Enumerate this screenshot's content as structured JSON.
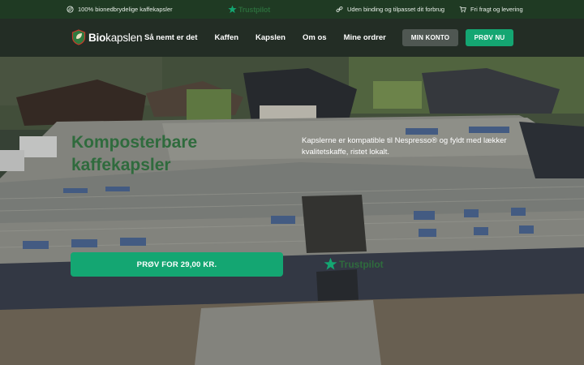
{
  "topbar": {
    "items": [
      {
        "icon": "leaf-icon",
        "text": "100% bionedbrydelige kaffekapsler"
      },
      {
        "icon": "link-icon",
        "text": "Uden binding og tilpasset dit forbrug"
      },
      {
        "icon": "cart-icon",
        "text": "Fri fragt og levering"
      }
    ],
    "trustpilot": "Trustpilot"
  },
  "navbar": {
    "logo_bold": "Bio",
    "logo_rest": "kapslen",
    "links": [
      "Så nemt er det",
      "Kaffen",
      "Kapslen",
      "Om os",
      "Mine ordrer"
    ],
    "account_label": "MIN KONTO",
    "try_label": "PRØV NU"
  },
  "hero": {
    "title_line1": "Komposterbare",
    "title_line2": "kaffekapsler",
    "description": "Kapslerne er kompatible til Nespresso® og fyldt med lækker kvalitetskaffe, ristet lokalt.",
    "cta_label": "PRØV FOR 29,00 KR.",
    "trustpilot": "Trustpilot"
  },
  "colors": {
    "accent": "#14a672",
    "topbar_bg": "#1f3a23",
    "navbar_bg": "#232d25",
    "title_green": "#2f6b3d"
  }
}
